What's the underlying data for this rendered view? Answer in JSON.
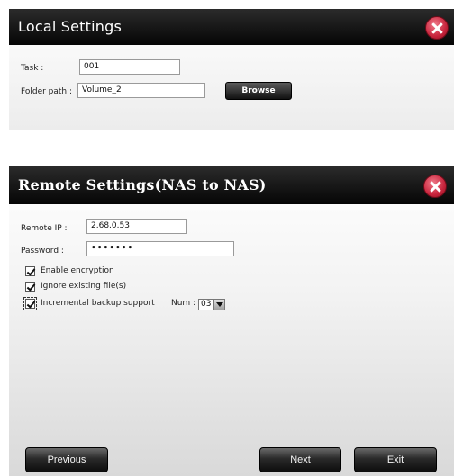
{
  "local": {
    "title": "Local Settings",
    "task_label": "Task :",
    "task_value": "001",
    "folder_label": "Folder path :",
    "folder_value": "Volume_2",
    "browse_label": "Browse"
  },
  "remote": {
    "title": "Remote Settings(NAS to NAS)",
    "ip_label": "Remote IP :",
    "ip_value": "2.68.0.53",
    "password_label": "Password :",
    "password_value": "•••••••",
    "encryption_label": "Enable encryption",
    "encryption_checked": true,
    "ignore_label": "Ignore existing file(s)",
    "ignore_checked": true,
    "incremental_label": "Incremental backup support",
    "incremental_checked": true,
    "num_label": "Num :",
    "num_value": "03"
  },
  "footer": {
    "previous_label": "Previous",
    "next_label": "Next",
    "exit_label": "Exit"
  },
  "icons": {
    "close": "close-icon",
    "dropdown": "chevron-down-icon"
  },
  "colors": {
    "titlebar": "#0a0a0a",
    "close_button": "#c8243c"
  }
}
